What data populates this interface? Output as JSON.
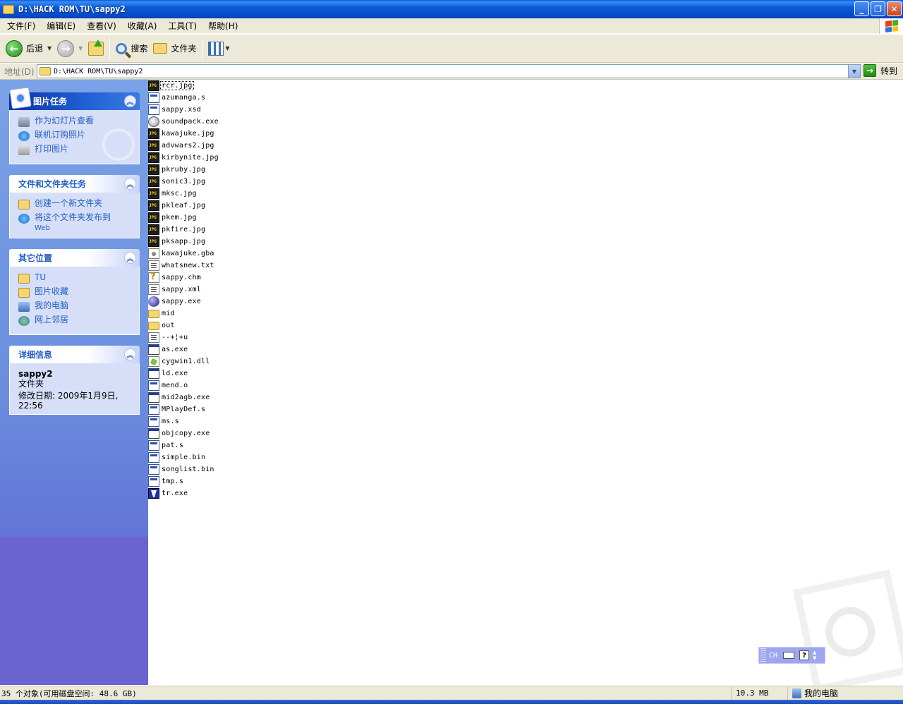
{
  "window": {
    "title": "D:\\HACK ROM\\TU\\sappy2"
  },
  "menu": [
    "文件(F)",
    "编辑(E)",
    "查看(V)",
    "收藏(A)",
    "工具(T)",
    "帮助(H)"
  ],
  "toolbar": {
    "back": "后退",
    "search": "搜索",
    "folders": "文件夹"
  },
  "address": {
    "label": "地址(D)",
    "path": "D:\\HACK ROM\\TU\\sappy2",
    "go": "转到"
  },
  "panels": {
    "picture_tasks": {
      "title": "图片任务",
      "items": [
        "作为幻灯片查看",
        "联机订购照片",
        "打印图片"
      ]
    },
    "file_tasks": {
      "title": "文件和文件夹任务",
      "items": [
        "创建一个新文件夹",
        "将这个文件夹发布到"
      ],
      "publish_sub": "Web"
    },
    "other_places": {
      "title": "其它位置",
      "items": [
        "TU",
        "图片收藏",
        "我的电脑",
        "网上邻居"
      ]
    },
    "details": {
      "title": "详细信息",
      "name": "sappy2",
      "type": "文件夹",
      "modified_label": "修改日期: 2009年1月9日,",
      "modified_time": "22:56"
    }
  },
  "files": [
    {
      "name": "rcr.jpg",
      "icon": "jpg"
    },
    {
      "name": "azumanga.s",
      "icon": "doc"
    },
    {
      "name": "sappy.xsd",
      "icon": "doc"
    },
    {
      "name": "soundpack.exe",
      "icon": "sound"
    },
    {
      "name": "kawajuke.jpg",
      "icon": "jpg"
    },
    {
      "name": "advwars2.jpg",
      "icon": "jpg"
    },
    {
      "name": "kirbynite.jpg",
      "icon": "jpg"
    },
    {
      "name": "pkruby.jpg",
      "icon": "jpg"
    },
    {
      "name": "sonic3.jpg",
      "icon": "jpg"
    },
    {
      "name": "mksc.jpg",
      "icon": "jpg"
    },
    {
      "name": "pkleaf.jpg",
      "icon": "jpg"
    },
    {
      "name": "pkem.jpg",
      "icon": "jpg"
    },
    {
      "name": "pkfire.jpg",
      "icon": "jpg"
    },
    {
      "name": "pksapp.jpg",
      "icon": "jpg"
    },
    {
      "name": "kawajuke.gba",
      "icon": "gba"
    },
    {
      "name": "whatsnew.txt",
      "icon": "txt"
    },
    {
      "name": "sappy.chm",
      "icon": "chm"
    },
    {
      "name": "sappy.xml",
      "icon": "txt"
    },
    {
      "name": "sappy.exe",
      "icon": "ball"
    },
    {
      "name": "mid",
      "icon": "folder"
    },
    {
      "name": "out",
      "icon": "folder"
    },
    {
      "name": "--+¦+u",
      "icon": "txt"
    },
    {
      "name": "as.exe",
      "icon": "exe"
    },
    {
      "name": "cygwin1.dll",
      "icon": "dll"
    },
    {
      "name": "ld.exe",
      "icon": "exe"
    },
    {
      "name": "mend.o",
      "icon": "doc"
    },
    {
      "name": "mid2agb.exe",
      "icon": "exe"
    },
    {
      "name": "MPlayDef.s",
      "icon": "doc"
    },
    {
      "name": "ms.s",
      "icon": "doc"
    },
    {
      "name": "objcopy.exe",
      "icon": "exe"
    },
    {
      "name": "pat.s",
      "icon": "doc"
    },
    {
      "name": "simple.bin",
      "icon": "doc"
    },
    {
      "name": "songlist.bin",
      "icon": "doc"
    },
    {
      "name": "tmp.s",
      "icon": "doc"
    },
    {
      "name": "tr.exe",
      "icon": "tr"
    }
  ],
  "langbar": {
    "lang": "CH"
  },
  "status": {
    "objects": "35 个对象(可用磁盘空间: 48.6 GB)",
    "size": "10.3 MB",
    "location": "我的电脑"
  }
}
